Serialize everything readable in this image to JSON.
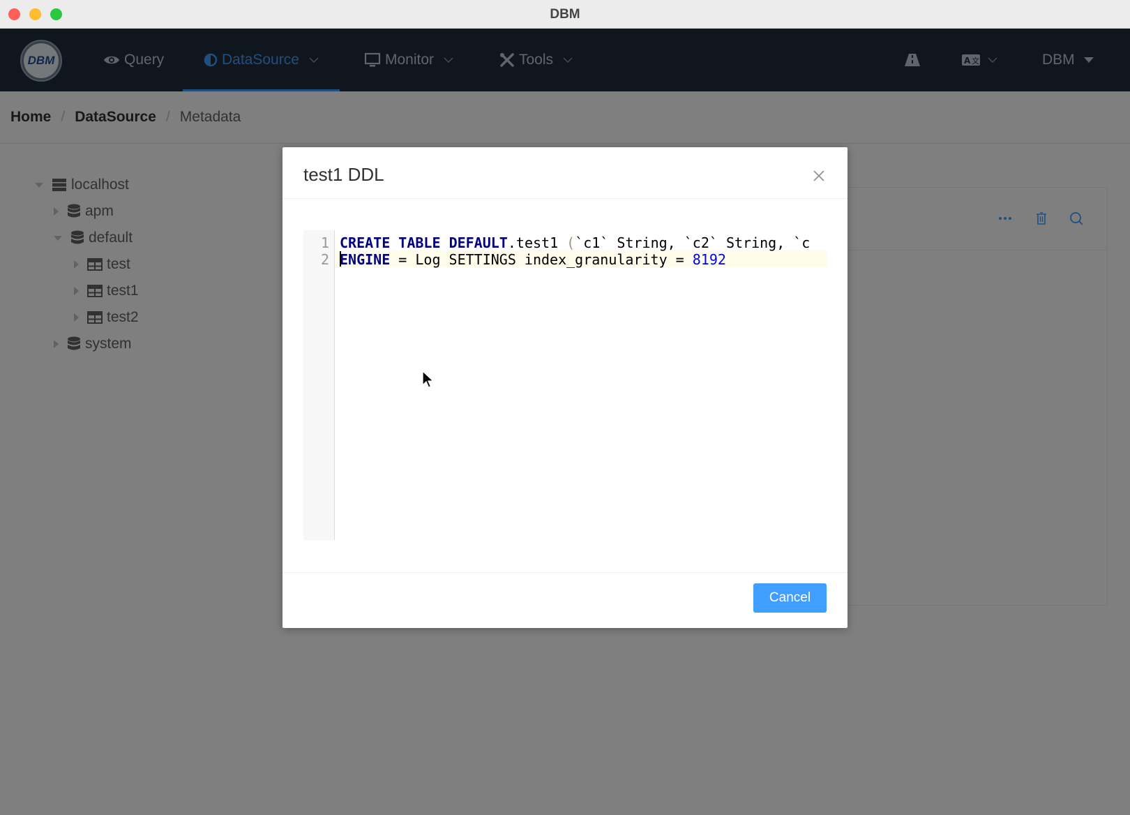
{
  "window": {
    "title": "DBM"
  },
  "nav": {
    "items": [
      {
        "label": "Query",
        "icon": "eye-icon"
      },
      {
        "label": "DataSource",
        "icon": "half-circle-icon",
        "active": true
      },
      {
        "label": "Monitor",
        "icon": "monitor-icon"
      },
      {
        "label": "Tools",
        "icon": "tools-icon"
      }
    ],
    "user": "DBM"
  },
  "breadcrumb": [
    "Home",
    "DataSource",
    "Metadata"
  ],
  "tree": [
    {
      "label": "localhost",
      "icon": "server-icon",
      "expanded": true
    },
    {
      "label": "apm",
      "icon": "database-icon",
      "expanded": false
    },
    {
      "label": "default",
      "icon": "database-icon",
      "expanded": true
    },
    {
      "label": "test",
      "icon": "table-icon",
      "expanded": false
    },
    {
      "label": "test1",
      "icon": "table-icon",
      "expanded": false
    },
    {
      "label": "test2",
      "icon": "table-icon",
      "expanded": false
    },
    {
      "label": "system",
      "icon": "database-icon",
      "expanded": false
    }
  ],
  "dialog": {
    "title": "test1 DDL",
    "line_numbers": [
      "1",
      "2"
    ],
    "code": {
      "line1": {
        "kw1": "CREATE",
        "kw2": "TABLE",
        "kw3": "DEFAULT",
        "rest": ".test1 ",
        "paren": "(",
        "tail": "`c1` String, `c2` String, `c"
      },
      "line2": {
        "kw1": "ENGINE",
        "rest": " = Log SETTINGS index_granularity = ",
        "num": "8192"
      }
    },
    "cancel_label": "Cancel"
  },
  "colors": {
    "accent": "#409eff",
    "nav_bg": "#1f2d3d"
  }
}
